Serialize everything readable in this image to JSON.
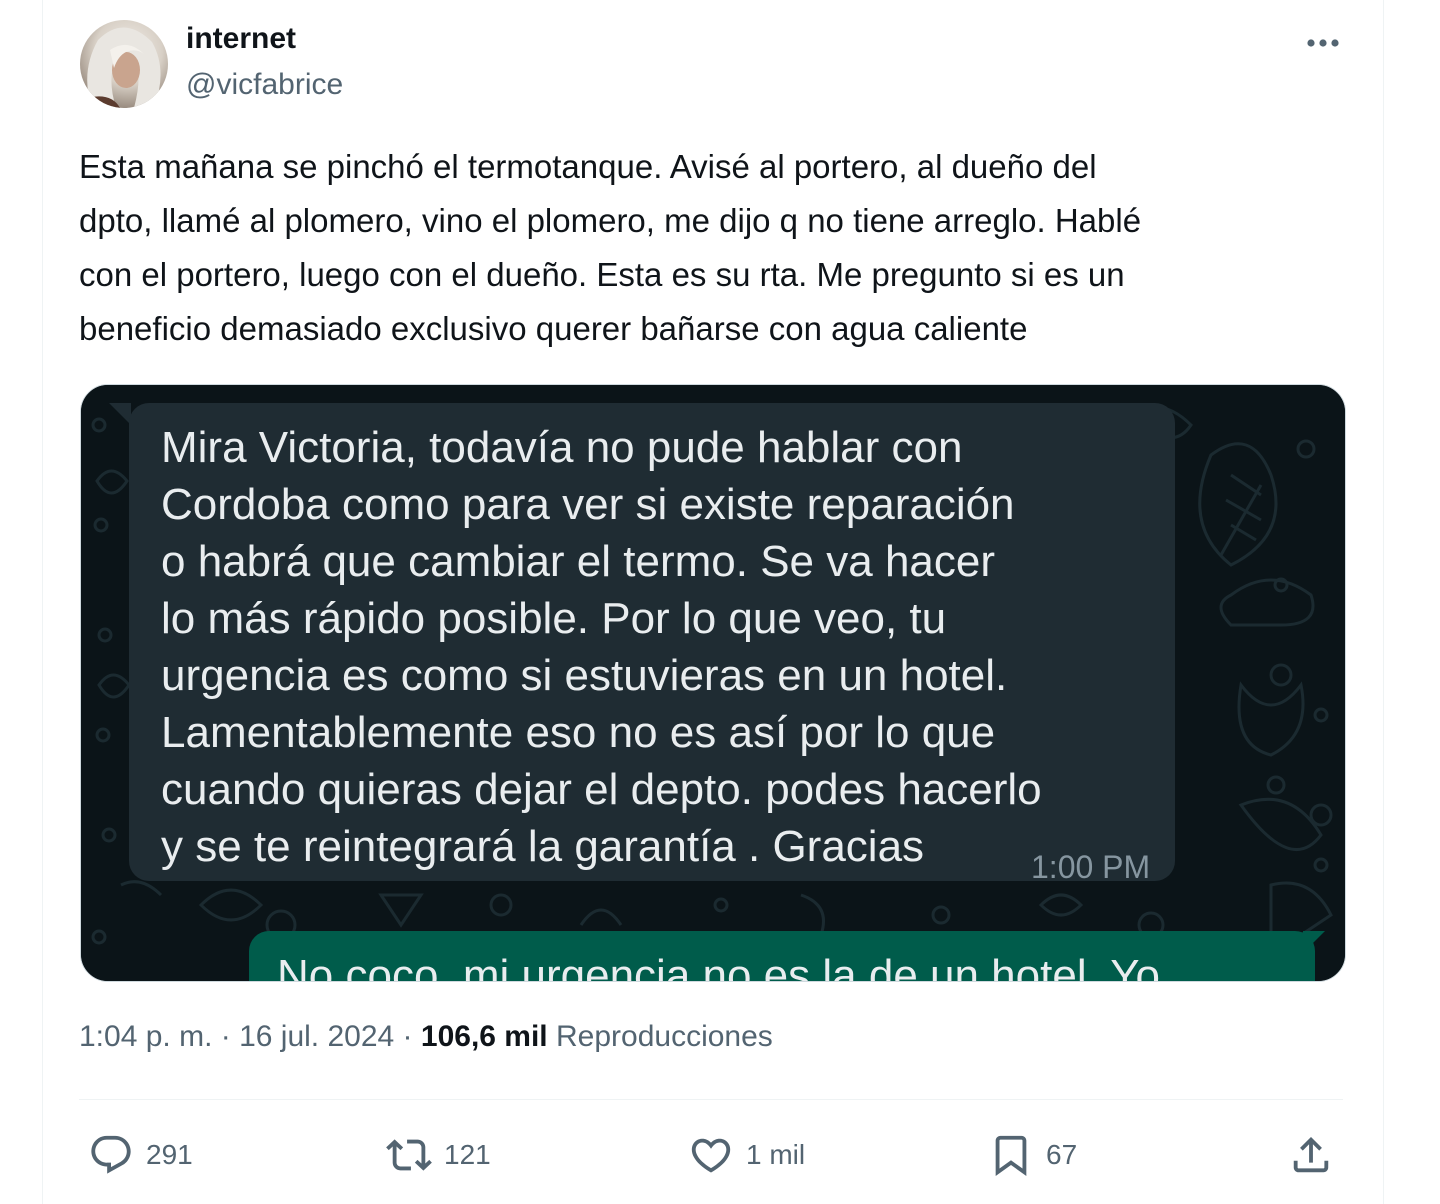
{
  "author": {
    "display_name": "internet",
    "handle": "@vicfabrice"
  },
  "tweet": {
    "text": "Esta mañana se pinchó el termotanque. Avisé al portero, al dueño del\ndpto, llamé al plomero, vino el plomero, me dijo q no tiene arreglo. Hablé\ncon el portero, luego con el dueño. Esta es su rta. Me pregunto si es un\nbeneficio demasiado exclusivo querer bañarse con agua caliente"
  },
  "media": {
    "incoming_message": "Mira Victoria, todavía no pude hablar con\nCordoba como para ver si existe reparación\no habrá que cambiar el termo. Se va hacer\nlo más rápido posible. Por lo que veo,  tu\nurgencia es como si estuvieras en un hotel.\nLamentablemente eso no es así por lo que\ncuando quieras dejar el depto. podes hacerlo\ny se te reintegrará la garantía . Gracias",
    "incoming_time": "1:00 PM",
    "outgoing_message_partial": "No coco, mi urgencia no es la de un hotel. Yo",
    "colors": {
      "incoming_bubble": "#1f2c33",
      "outgoing_bubble": "#005c4b",
      "chat_bg": "#0b1418"
    }
  },
  "meta": {
    "time": "1:04 p. m.",
    "separator": " · ",
    "date": "16 jul. 2024",
    "views_count": "106,6 mil",
    "views_label": "Reproducciones"
  },
  "actions": {
    "replies": "291",
    "retweets": "121",
    "likes": "1 mil",
    "bookmarks": "67"
  },
  "icons": [
    "more-icon",
    "reply-icon",
    "retweet-icon",
    "like-icon",
    "bookmark-icon",
    "share-icon"
  ]
}
